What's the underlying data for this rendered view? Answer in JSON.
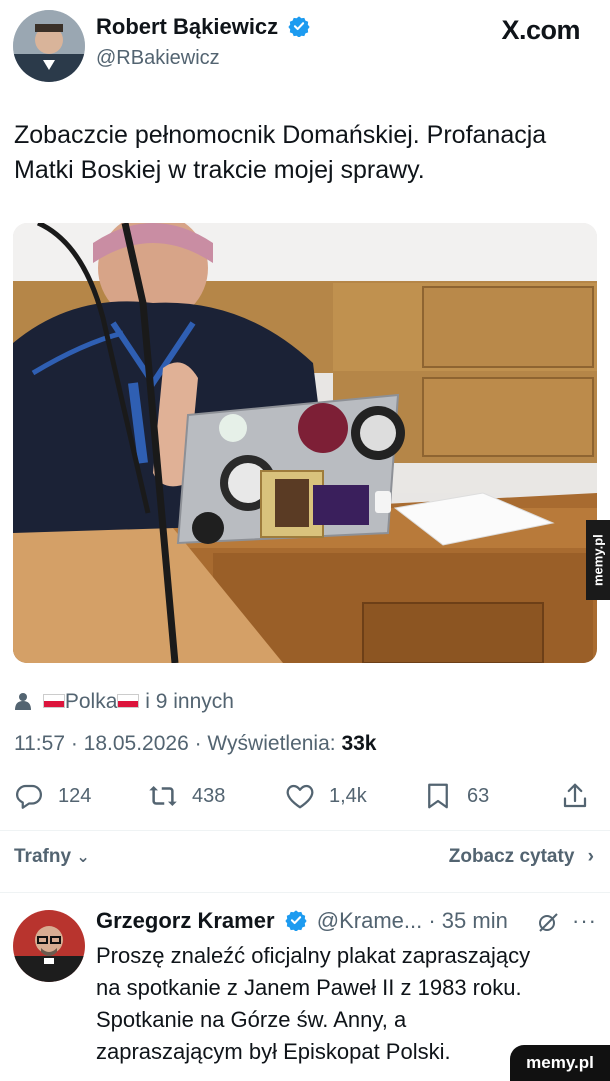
{
  "header": {
    "author_name": "Robert Bąkiewicz",
    "author_handle": "@RBakiewicz",
    "site_logo": "X.com"
  },
  "tweet": {
    "text_line1": "Zobaczcie pełnomocnik Domańskiej. Profanacja",
    "text_line2": "Matki Boskiej w trakcie mojej sprawy.",
    "likers": {
      "name": "Polka",
      "others": "i 9 innych"
    },
    "meta": {
      "time_date": "11:57 · 18.05.2026 · ",
      "views_label": "Wyświetlenia: ",
      "views_value": "33k"
    },
    "actions": {
      "reply_count": "124",
      "retweet_count": "438",
      "like_count": "1,4k",
      "bookmark_count": "63"
    }
  },
  "replies_header": {
    "sort_label": "Trafny",
    "quotes_link": "Zobacz cytaty"
  },
  "reply": {
    "author_name": "Grzegorz Kramer",
    "author_handle": "@Krame...",
    "time": "· 35 min",
    "text_line1": "Proszę znaleźć oficjalny plakat zapraszający",
    "text_line2": "na spotkanie z Janem Paweł II z 1983 roku.",
    "text_line3": "Spotkanie na Górze św. Anny, a",
    "text_line4": "zapraszającym był Episkopat Polski."
  },
  "watermarks": {
    "side": "memy.pl",
    "bottom": "memy.pl"
  },
  "colors": {
    "verified_blue": "#1d9bf0",
    "text_primary": "#0f1419",
    "text_secondary": "#536471"
  }
}
